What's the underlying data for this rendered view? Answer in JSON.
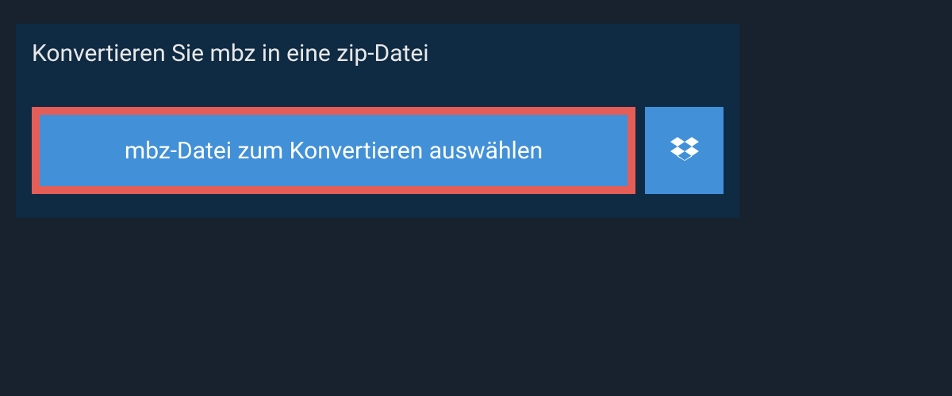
{
  "title": "Konvertieren Sie mbz in eine zip-Datei",
  "select_button_label": "mbz-Datei zum Konvertieren auswählen",
  "colors": {
    "background": "#18222e",
    "panel": "#0f2a43",
    "button": "#4190d8",
    "highlight_border": "#e45d56",
    "text_light": "#e8e8e8",
    "text_white": "#ffffff"
  },
  "icons": {
    "dropbox": "dropbox-icon"
  }
}
